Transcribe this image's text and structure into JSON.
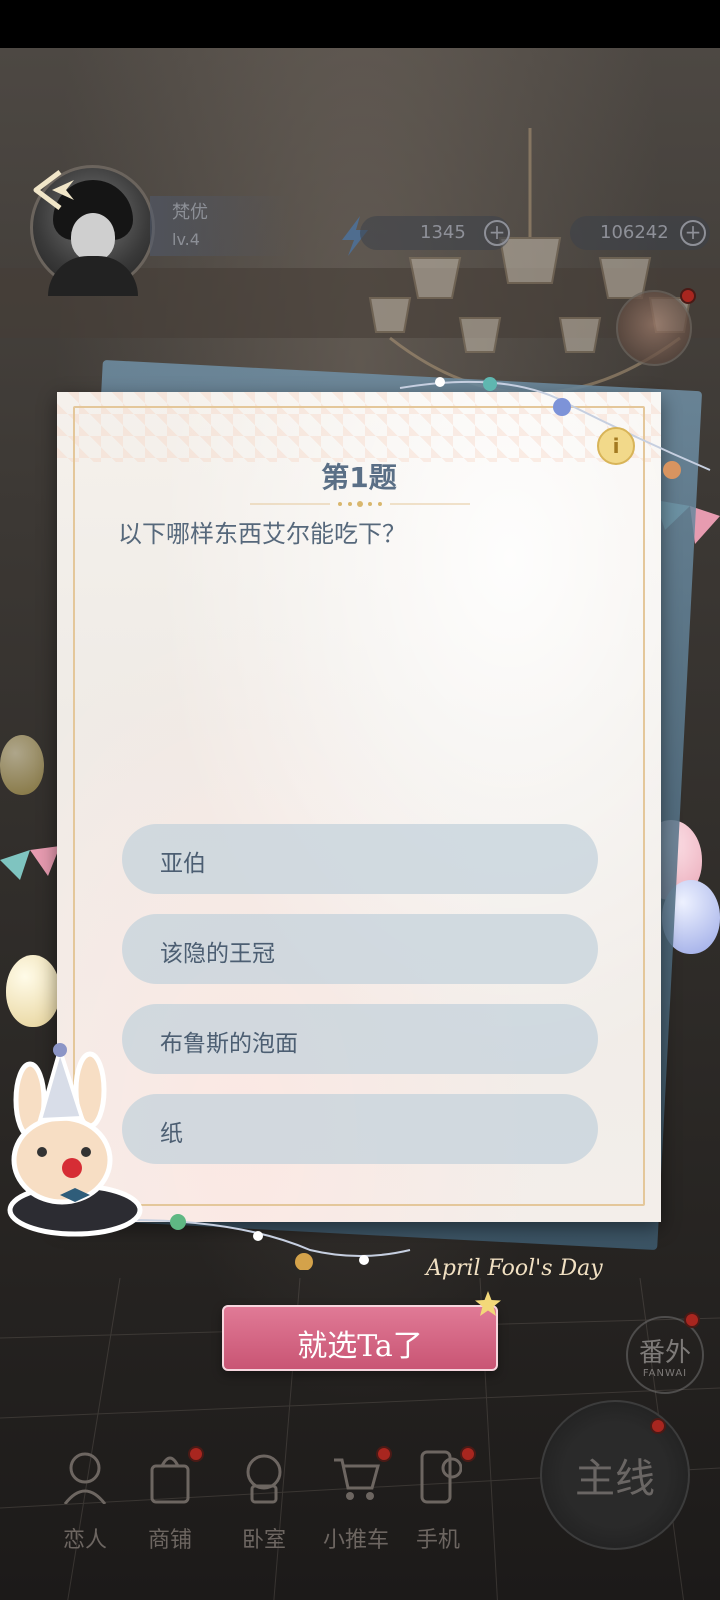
{
  "hud": {
    "player_name": "梵优",
    "player_level": "lv.4",
    "energy_value": "1345",
    "currency_value": "106242",
    "plus_symbol": "+"
  },
  "quiz": {
    "title": "第1题",
    "question": "以下哪样东西艾尔能吃下？",
    "info_label": "i",
    "options": [
      {
        "label": "亚伯"
      },
      {
        "label": "该隐的王冠"
      },
      {
        "label": "布鲁斯的泡面"
      },
      {
        "label": "纸"
      }
    ],
    "confirm_label": "就选Ta了",
    "event_caption": "April Fool's Day"
  },
  "side": {
    "fanwai_cn": "番外",
    "fanwai_en": "FANWAI",
    "main_story": "主线"
  },
  "nav": {
    "items": [
      {
        "label": "恋人",
        "icon": "lover-icon"
      },
      {
        "label": "商铺",
        "icon": "shop-bag-icon"
      },
      {
        "label": "卧室",
        "icon": "bedroom-icon"
      },
      {
        "label": "小推车",
        "icon": "cart-icon"
      },
      {
        "label": "手机",
        "icon": "phone-icon"
      }
    ]
  },
  "colors": {
    "confirm_pink": "#d8657f",
    "option_bg": "#c7d3dc",
    "title_blue": "#5a6f86",
    "frame_gold": "#e4c79a"
  }
}
